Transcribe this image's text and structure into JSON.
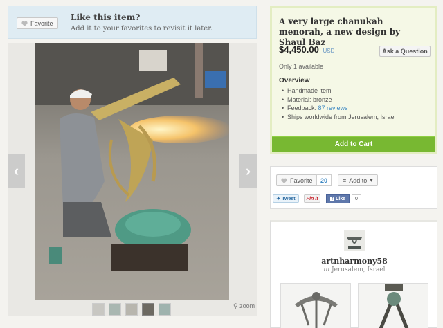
{
  "favorite_banner": {
    "button_label": "Favorite",
    "title": "Like this item?",
    "subtitle": "Add it to your favorites to revisit it later."
  },
  "gallery": {
    "zoom_label": "zoom",
    "prev_arrow": "‹",
    "next_arrow": "›",
    "thumbnail_count": 5
  },
  "listing": {
    "title": "A very large chanukah menorah, a new design by Shaul Baz",
    "price": "$4,450.00",
    "currency": "USD",
    "ask_button": "Ask a Question",
    "availability": "Only 1 available",
    "overview_heading": "Overview",
    "overview_items": [
      "Handmade item",
      "Material: bronze",
      "Feedback: ",
      "Ships worldwide from Jerusalem, Israel"
    ],
    "feedback_link": "87 reviews",
    "cart_button": "Add to Cart"
  },
  "social": {
    "favorite_label": "Favorite",
    "favorite_count": "20",
    "add_to_label": "Add to",
    "tweet_label": "Tweet",
    "pinit_label": "Pin it",
    "fb_like_label": "Like",
    "fb_like_count": "0"
  },
  "shop": {
    "name": "artnharmony58",
    "location_prefix": "in",
    "location": "Jerusalem, Israel"
  },
  "colors": {
    "accent_green": "#78b832",
    "link_blue": "#3d88c3",
    "banner_blue": "#dfecf3"
  }
}
